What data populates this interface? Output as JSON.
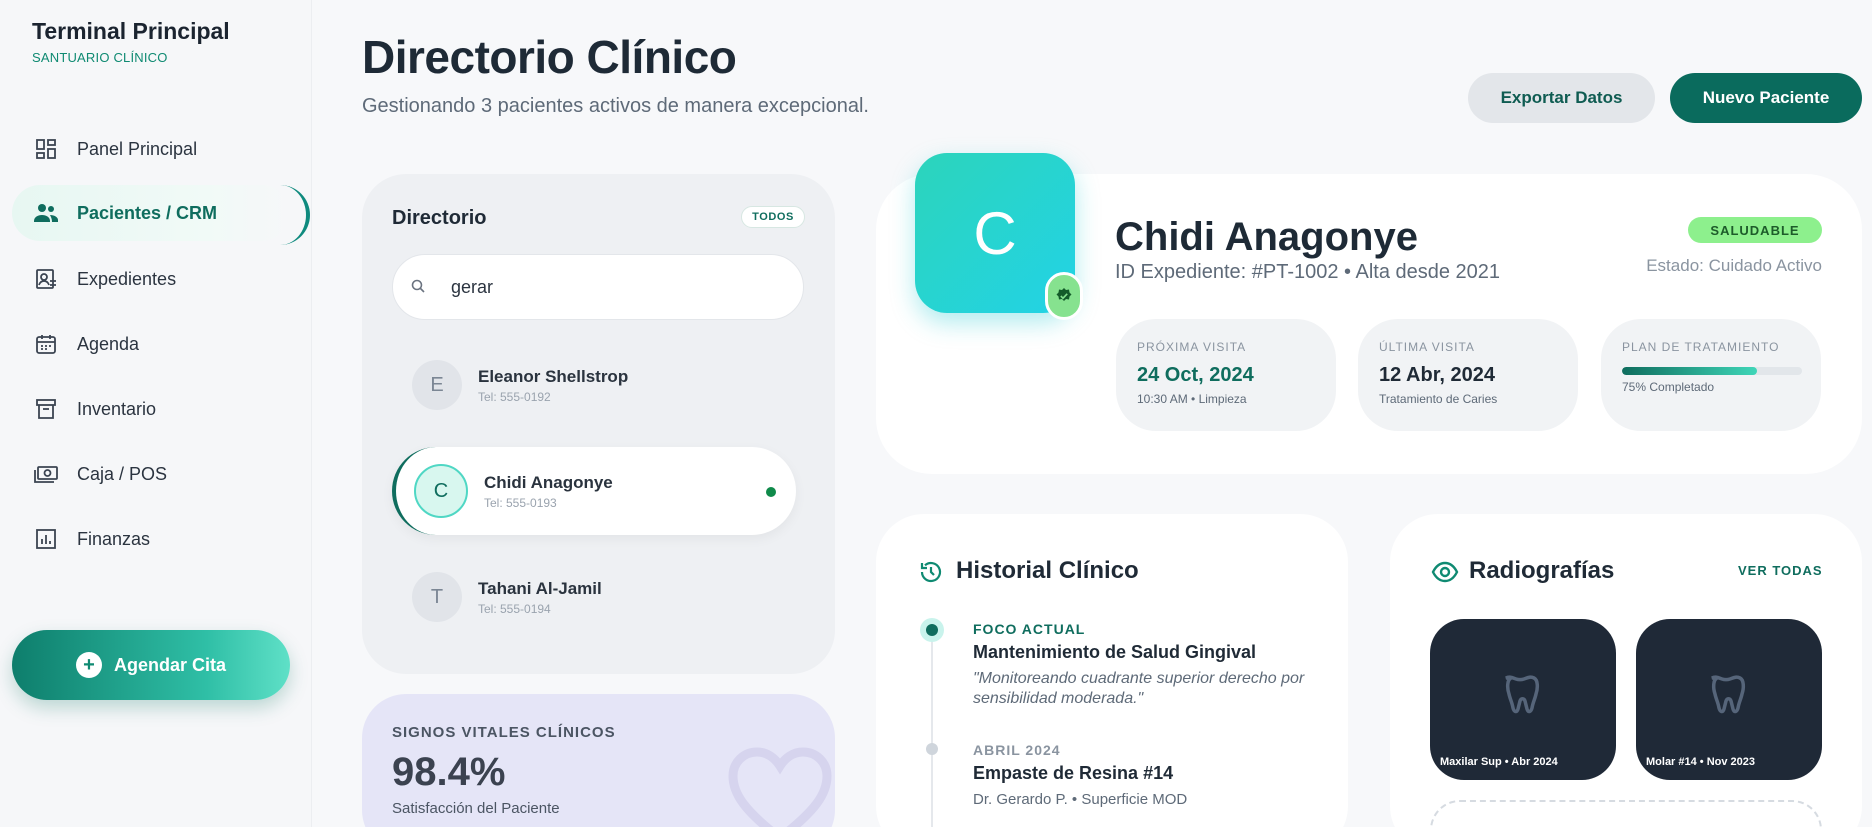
{
  "brand": {
    "title": "Terminal Principal",
    "subtitle": "SANTUARIO CLÍNICO"
  },
  "nav": [
    {
      "label": "Panel Principal",
      "icon": "dashboard-icon"
    },
    {
      "label": "Pacientes / CRM",
      "icon": "users-icon",
      "active": true
    },
    {
      "label": "Expedientes",
      "icon": "records-icon"
    },
    {
      "label": "Agenda",
      "icon": "calendar-icon"
    },
    {
      "label": "Inventario",
      "icon": "archive-icon"
    },
    {
      "label": "Caja / POS",
      "icon": "cash-icon"
    },
    {
      "label": "Finanzas",
      "icon": "chart-icon"
    }
  ],
  "cta": {
    "label": "Agendar Cita",
    "icon": "plus-circle-icon"
  },
  "header": {
    "title": "Directorio Clínico",
    "subtitle": "Gestionando 3 pacientes activos de manera excepcional.",
    "export_label": "Exportar Datos",
    "new_label": "Nuevo Paciente"
  },
  "directory": {
    "title": "Directorio",
    "filter": "TODOS",
    "search_value": "gerar",
    "patients": [
      {
        "initial": "E",
        "name": "Eleanor Shellstrop",
        "phone": "Tel: 555-0192"
      },
      {
        "initial": "C",
        "name": "Chidi Anagonye",
        "phone": "Tel: 555-0193",
        "selected": true
      },
      {
        "initial": "T",
        "name": "Tahani Al-Jamil",
        "phone": "Tel: 555-0194"
      }
    ]
  },
  "vitals": {
    "label": "SIGNOS VITALES CLÍNICOS",
    "value": "98.4%",
    "sub": "Satisfacción del Paciente"
  },
  "patient": {
    "initial": "C",
    "name": "Chidi Anagonye",
    "id_line": "ID Expediente: #PT-1002 • Alta desde 2021",
    "badge": "SALUDABLE",
    "state": "Estado: Cuidado Activo",
    "stats": [
      {
        "label": "PRÓXIMA VISITA",
        "value": "24 Oct, 2024",
        "sub": "10:30 AM • Limpieza"
      },
      {
        "label": "ÚLTIMA VISITA",
        "value": "12 Abr, 2024",
        "sub": "Tratamiento de Caries"
      },
      {
        "label": "PLAN DE TRATAMIENTO",
        "progress": 0.75,
        "sub": "75% Completado"
      }
    ]
  },
  "history": {
    "title": "Historial Clínico",
    "items": [
      {
        "label": "FOCO ACTUAL",
        "title": "Mantenimiento de Salud Gingival",
        "note": "\"Monitoreando cuadrante superior derecho por sensibilidad moderada.\""
      },
      {
        "label": "ABRIL 2024",
        "title": "Empaste de Resina #14",
        "note": "Dr. Gerardo P. • Superficie MOD"
      }
    ]
  },
  "xrays": {
    "title": "Radiografías",
    "view_all": "VER TODAS",
    "items": [
      {
        "caption": "Maxilar Sup • Abr 2024"
      },
      {
        "caption": "Molar #14 • Nov 2023"
      }
    ]
  }
}
